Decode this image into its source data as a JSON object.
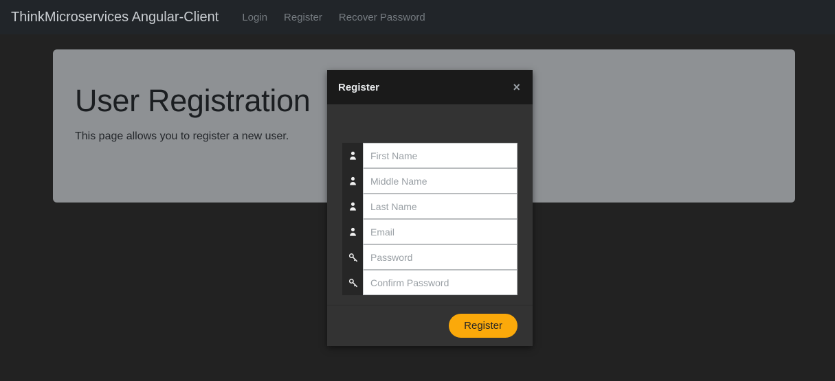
{
  "navbar": {
    "brand": "ThinkMicroservices Angular-Client",
    "links": [
      {
        "label": "Login",
        "name": "nav-link-login"
      },
      {
        "label": "Register",
        "name": "nav-link-register"
      },
      {
        "label": "Recover Password",
        "name": "nav-link-recover-password"
      }
    ]
  },
  "jumbotron": {
    "title": "User Registration",
    "lead": "This page allows you to register a new user."
  },
  "modal": {
    "title": "Register",
    "close_label": "×",
    "fields": [
      {
        "placeholder": "First Name",
        "icon": "user-icon",
        "type": "text",
        "name": "first-name-field"
      },
      {
        "placeholder": "Middle Name",
        "icon": "user-icon",
        "type": "text",
        "name": "middle-name-field"
      },
      {
        "placeholder": "Last Name",
        "icon": "user-icon",
        "type": "text",
        "name": "last-name-field"
      },
      {
        "placeholder": "Email",
        "icon": "user-icon",
        "type": "text",
        "name": "email-field"
      },
      {
        "placeholder": "Password",
        "icon": "key-icon",
        "type": "password",
        "name": "password-field"
      },
      {
        "placeholder": "Confirm Password",
        "icon": "key-icon",
        "type": "password",
        "name": "confirm-password-field"
      }
    ],
    "submit_label": "Register"
  },
  "colors": {
    "navbar_bg": "#212529",
    "body_bg": "#222222",
    "jumbotron_bg": "#8e9194",
    "modal_header_bg": "#1a1a1a",
    "modal_body_bg": "#333333",
    "accent": "#fba90a"
  }
}
